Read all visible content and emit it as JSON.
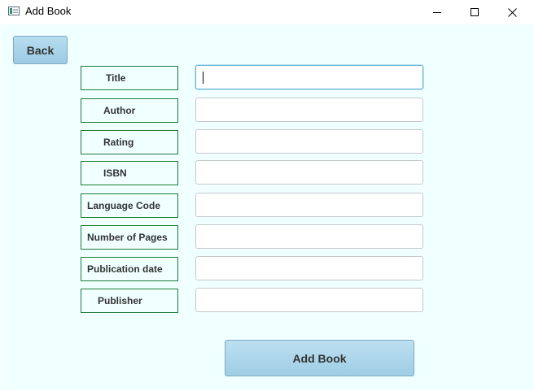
{
  "window": {
    "title": "Add Book",
    "icon": "app-window-icon"
  },
  "back_label": "Back",
  "fields": [
    {
      "label": "Title",
      "value": "",
      "focused": true
    },
    {
      "label": "Author",
      "value": ""
    },
    {
      "label": "Rating",
      "value": ""
    },
    {
      "label": "ISBN",
      "value": ""
    },
    {
      "label": "Language Code",
      "value": ""
    },
    {
      "label": "Number of Pages",
      "value": ""
    },
    {
      "label": "Publication date",
      "value": ""
    },
    {
      "label": "Publisher",
      "value": ""
    }
  ],
  "add_label": "Add Book",
  "colors": {
    "background": "#f0ffff",
    "label_border": "#1f7a33",
    "button": "#a9d4ea",
    "focus": "#5fb3d6"
  }
}
